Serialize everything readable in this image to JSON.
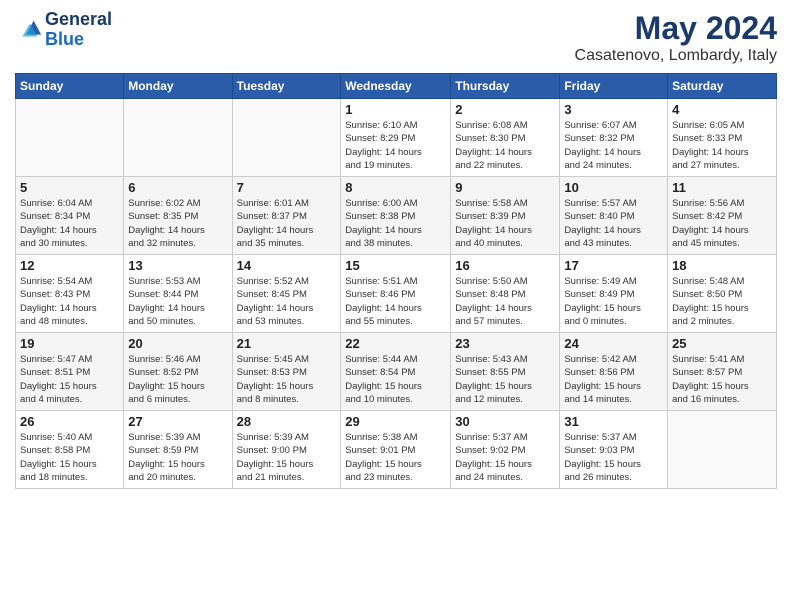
{
  "header": {
    "logo_line1": "General",
    "logo_line2": "Blue",
    "month": "May 2024",
    "location": "Casatenovo, Lombardy, Italy"
  },
  "weekdays": [
    "Sunday",
    "Monday",
    "Tuesday",
    "Wednesday",
    "Thursday",
    "Friday",
    "Saturday"
  ],
  "weeks": [
    [
      {
        "day": "",
        "info": ""
      },
      {
        "day": "",
        "info": ""
      },
      {
        "day": "",
        "info": ""
      },
      {
        "day": "1",
        "info": "Sunrise: 6:10 AM\nSunset: 8:29 PM\nDaylight: 14 hours\nand 19 minutes."
      },
      {
        "day": "2",
        "info": "Sunrise: 6:08 AM\nSunset: 8:30 PM\nDaylight: 14 hours\nand 22 minutes."
      },
      {
        "day": "3",
        "info": "Sunrise: 6:07 AM\nSunset: 8:32 PM\nDaylight: 14 hours\nand 24 minutes."
      },
      {
        "day": "4",
        "info": "Sunrise: 6:05 AM\nSunset: 8:33 PM\nDaylight: 14 hours\nand 27 minutes."
      }
    ],
    [
      {
        "day": "5",
        "info": "Sunrise: 6:04 AM\nSunset: 8:34 PM\nDaylight: 14 hours\nand 30 minutes."
      },
      {
        "day": "6",
        "info": "Sunrise: 6:02 AM\nSunset: 8:35 PM\nDaylight: 14 hours\nand 32 minutes."
      },
      {
        "day": "7",
        "info": "Sunrise: 6:01 AM\nSunset: 8:37 PM\nDaylight: 14 hours\nand 35 minutes."
      },
      {
        "day": "8",
        "info": "Sunrise: 6:00 AM\nSunset: 8:38 PM\nDaylight: 14 hours\nand 38 minutes."
      },
      {
        "day": "9",
        "info": "Sunrise: 5:58 AM\nSunset: 8:39 PM\nDaylight: 14 hours\nand 40 minutes."
      },
      {
        "day": "10",
        "info": "Sunrise: 5:57 AM\nSunset: 8:40 PM\nDaylight: 14 hours\nand 43 minutes."
      },
      {
        "day": "11",
        "info": "Sunrise: 5:56 AM\nSunset: 8:42 PM\nDaylight: 14 hours\nand 45 minutes."
      }
    ],
    [
      {
        "day": "12",
        "info": "Sunrise: 5:54 AM\nSunset: 8:43 PM\nDaylight: 14 hours\nand 48 minutes."
      },
      {
        "day": "13",
        "info": "Sunrise: 5:53 AM\nSunset: 8:44 PM\nDaylight: 14 hours\nand 50 minutes."
      },
      {
        "day": "14",
        "info": "Sunrise: 5:52 AM\nSunset: 8:45 PM\nDaylight: 14 hours\nand 53 minutes."
      },
      {
        "day": "15",
        "info": "Sunrise: 5:51 AM\nSunset: 8:46 PM\nDaylight: 14 hours\nand 55 minutes."
      },
      {
        "day": "16",
        "info": "Sunrise: 5:50 AM\nSunset: 8:48 PM\nDaylight: 14 hours\nand 57 minutes."
      },
      {
        "day": "17",
        "info": "Sunrise: 5:49 AM\nSunset: 8:49 PM\nDaylight: 15 hours\nand 0 minutes."
      },
      {
        "day": "18",
        "info": "Sunrise: 5:48 AM\nSunset: 8:50 PM\nDaylight: 15 hours\nand 2 minutes."
      }
    ],
    [
      {
        "day": "19",
        "info": "Sunrise: 5:47 AM\nSunset: 8:51 PM\nDaylight: 15 hours\nand 4 minutes."
      },
      {
        "day": "20",
        "info": "Sunrise: 5:46 AM\nSunset: 8:52 PM\nDaylight: 15 hours\nand 6 minutes."
      },
      {
        "day": "21",
        "info": "Sunrise: 5:45 AM\nSunset: 8:53 PM\nDaylight: 15 hours\nand 8 minutes."
      },
      {
        "day": "22",
        "info": "Sunrise: 5:44 AM\nSunset: 8:54 PM\nDaylight: 15 hours\nand 10 minutes."
      },
      {
        "day": "23",
        "info": "Sunrise: 5:43 AM\nSunset: 8:55 PM\nDaylight: 15 hours\nand 12 minutes."
      },
      {
        "day": "24",
        "info": "Sunrise: 5:42 AM\nSunset: 8:56 PM\nDaylight: 15 hours\nand 14 minutes."
      },
      {
        "day": "25",
        "info": "Sunrise: 5:41 AM\nSunset: 8:57 PM\nDaylight: 15 hours\nand 16 minutes."
      }
    ],
    [
      {
        "day": "26",
        "info": "Sunrise: 5:40 AM\nSunset: 8:58 PM\nDaylight: 15 hours\nand 18 minutes."
      },
      {
        "day": "27",
        "info": "Sunrise: 5:39 AM\nSunset: 8:59 PM\nDaylight: 15 hours\nand 20 minutes."
      },
      {
        "day": "28",
        "info": "Sunrise: 5:39 AM\nSunset: 9:00 PM\nDaylight: 15 hours\nand 21 minutes."
      },
      {
        "day": "29",
        "info": "Sunrise: 5:38 AM\nSunset: 9:01 PM\nDaylight: 15 hours\nand 23 minutes."
      },
      {
        "day": "30",
        "info": "Sunrise: 5:37 AM\nSunset: 9:02 PM\nDaylight: 15 hours\nand 24 minutes."
      },
      {
        "day": "31",
        "info": "Sunrise: 5:37 AM\nSunset: 9:03 PM\nDaylight: 15 hours\nand 26 minutes."
      },
      {
        "day": "",
        "info": ""
      }
    ]
  ]
}
